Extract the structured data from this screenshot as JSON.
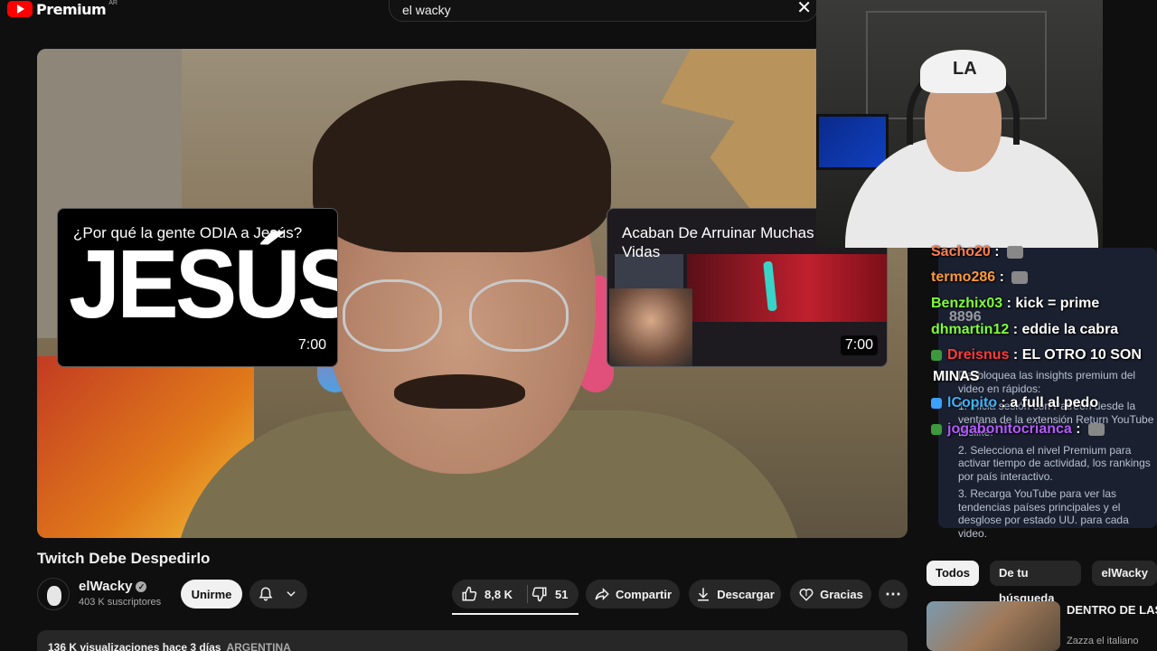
{
  "header": {
    "brand": "Premium",
    "region": "AR",
    "search_query": "el wacky"
  },
  "video": {
    "title": "Twitch Debe Despedirlo"
  },
  "end_cards": [
    {
      "title": "¿Por qué la gente ODIA a Jesús?",
      "big_text": "JESÚS",
      "duration": "7:00"
    },
    {
      "title": "Acaban De Arruinar Muchas Vidas",
      "duration": "7:00"
    }
  ],
  "channel": {
    "name": "elWacky",
    "subscribers": "403 K suscriptores",
    "join_label": "Unirme"
  },
  "actions": {
    "likes": "8,8 K",
    "dislikes": "51",
    "share": "Compartir",
    "download": "Descargar",
    "thanks": "Gracias",
    "more": "⋯"
  },
  "description": {
    "stats": "136 K visualizaciones  hace 3 días",
    "tag": "ARGENTINA"
  },
  "chat": [
    {
      "user": "Sacho20",
      "text": "",
      "color": "#ff7f50"
    },
    {
      "user": "termo286",
      "text": "",
      "color": "#ff9a3c"
    },
    {
      "user": "Benzhix03",
      "text": "kick = prime",
      "color": "#7fff3c"
    },
    {
      "user": "dhmartin12",
      "text": "eddie la cabra",
      "color": "#7fff3c"
    },
    {
      "user": "Dreisnus",
      "text": "EL OTRO 10 SON",
      "color": "#ff3c3c"
    },
    {
      "user": "",
      "text": "MINAS",
      "color": "#ffffff"
    },
    {
      "user": "lCopito",
      "text": "a full al pedo",
      "color": "#3cb4ff"
    },
    {
      "user": "jogabonitocrianca",
      "text": "",
      "color": "#b45aff"
    }
  ],
  "overlay_number": "8896",
  "premium_panel": {
    "intro": "Desbloquea las insights premium del video en rápidos:",
    "steps": [
      "1. Inicia sesión con Patreon desde la ventana de la extensión Return YouTube Dislike.",
      "2. Selecciona el nivel Premium para activar tiempo de actividad, los rankings por país interactivo.",
      "3. Recarga YouTube para ver las tendencias países principales y el desglose por estado UU. para cada video."
    ]
  },
  "chips": [
    "Todos",
    "De tu búsqueda",
    "elWacky"
  ],
  "recommendation": {
    "title": "DENTRO DE LAS V LA VILLA MÁS LO",
    "channel": "Zazza el italiano"
  },
  "webcam": {
    "cap_logo": "LA"
  },
  "colors": {
    "accent": "#ff0000",
    "background": "#0f0f0f",
    "surface": "#272727"
  }
}
